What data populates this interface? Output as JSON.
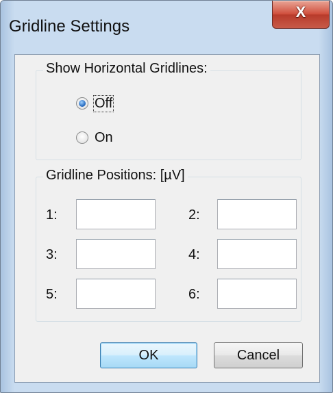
{
  "window": {
    "title": "Gridline Settings",
    "close_symbol": "X"
  },
  "horizontal_gridlines": {
    "legend": "Show Horizontal Gridlines:",
    "options": [
      {
        "label": "Off",
        "checked": true
      },
      {
        "label": "On",
        "checked": false
      }
    ]
  },
  "positions": {
    "legend": "Gridline Positions: [µV]",
    "fields": [
      {
        "label": "1:",
        "value": ""
      },
      {
        "label": "2:",
        "value": ""
      },
      {
        "label": "3:",
        "value": ""
      },
      {
        "label": "4:",
        "value": ""
      },
      {
        "label": "5:",
        "value": ""
      },
      {
        "label": "6:",
        "value": ""
      }
    ]
  },
  "buttons": {
    "ok": "OK",
    "cancel": "Cancel"
  },
  "colors": {
    "close_button": "#c9503f",
    "default_button_border": "#3c7fb1",
    "window_frame": "#c9dcf0"
  }
}
